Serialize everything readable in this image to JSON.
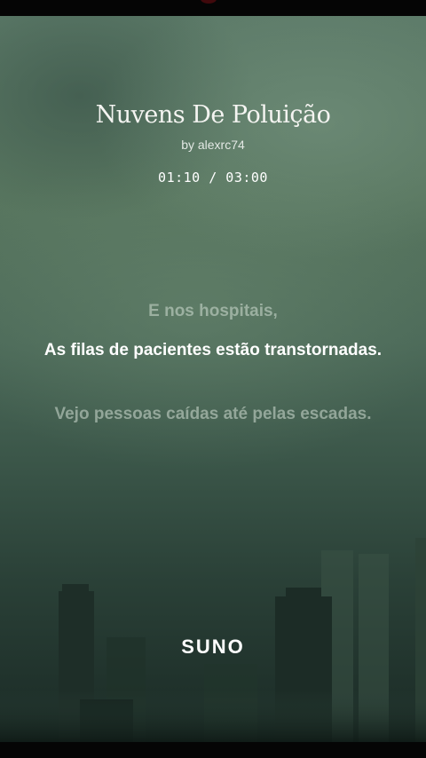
{
  "song": {
    "title": "Nuvens De Poluição",
    "artist": "by alexrc74",
    "elapsed": "01:10",
    "duration": "03:00",
    "time_display": "01:10 / 03:00"
  },
  "lyrics": {
    "previous": "E nos hospitais,",
    "current": "As filas de pacientes estão transtornadas.",
    "next": "Vejo pessoas caídas até pelas escadas."
  },
  "brand": {
    "logo_text": "SUNO"
  },
  "colors": {
    "sky_top": "#5c7a68",
    "sky_bottom": "#1a2a25",
    "text_active": "#ffffff",
    "text_dim": "#a9b8ad"
  }
}
